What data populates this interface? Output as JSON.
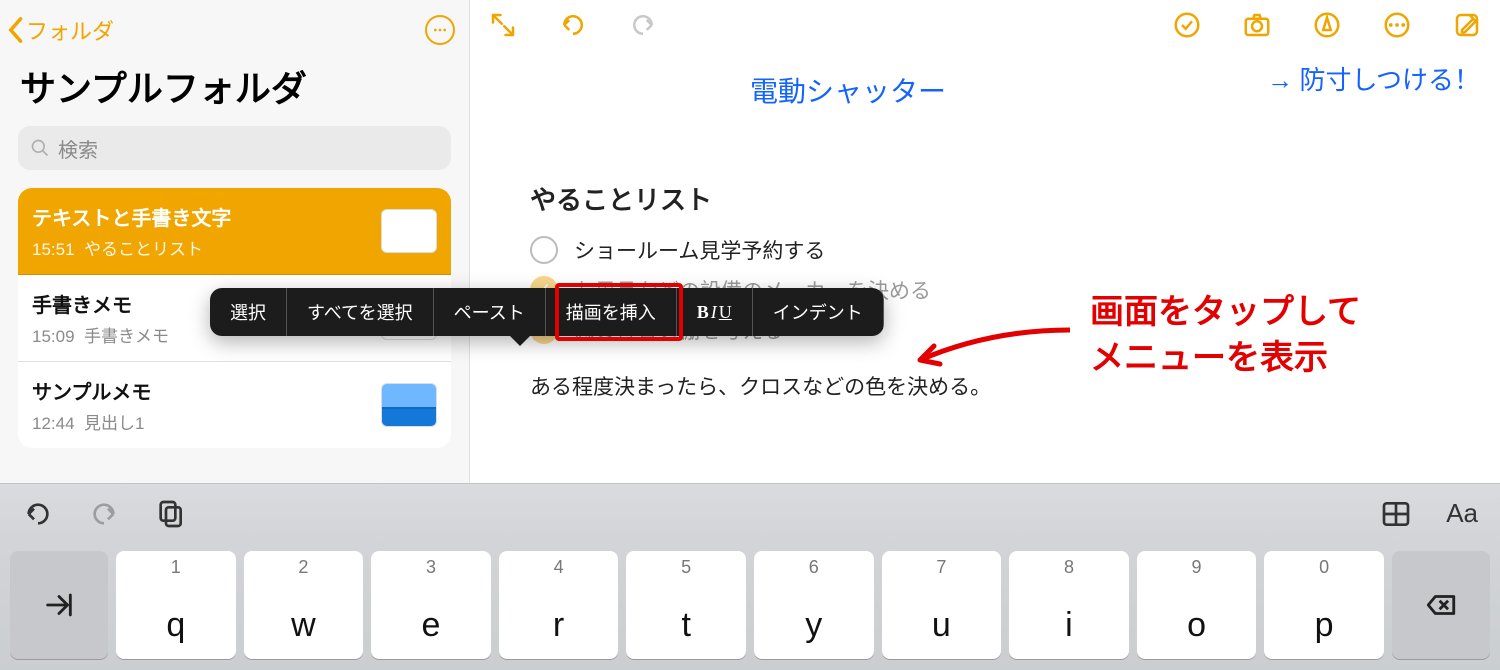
{
  "sidebar": {
    "back_label": "フォルダ",
    "title": "サンプルフォルダ",
    "search_placeholder": "検索",
    "items": [
      {
        "name": "テキストと手書き文字",
        "time": "15:51",
        "sub": "やることリスト",
        "selected": true
      },
      {
        "name": "手書きメモ",
        "time": "15:09",
        "sub": "手書きメモ",
        "selected": false
      },
      {
        "name": "サンプルメモ",
        "time": "12:44",
        "sub": "見出し1",
        "selected": false
      }
    ]
  },
  "note": {
    "handwriting_1": "電動シャッター",
    "handwriting_2": "→ 防寸しつける！",
    "heading": "やることリスト",
    "checks": [
      {
        "done": false,
        "text": "ショールーム見学予約する"
      },
      {
        "done": true,
        "text": "お風呂などの設備のメーカーを決める"
      },
      {
        "done": true,
        "text": "窓の位置と棚を考える"
      }
    ],
    "paragraph": "ある程度決まったら、クロスなどの色を決める。"
  },
  "context_menu": {
    "items": [
      "選択",
      "すべてを選択",
      "ペースト",
      "描画を挿入",
      "BIU",
      "インデント"
    ],
    "highlight_index": 3
  },
  "annotation": {
    "line1": "画面をタップして",
    "line2": "メニューを表示"
  },
  "keyboard": {
    "numbers": [
      "1",
      "2",
      "3",
      "4",
      "5",
      "6",
      "7",
      "8",
      "9",
      "0"
    ],
    "row": [
      "q",
      "w",
      "e",
      "r",
      "t",
      "y",
      "u",
      "i",
      "o",
      "p"
    ],
    "format_label": "Aa"
  }
}
